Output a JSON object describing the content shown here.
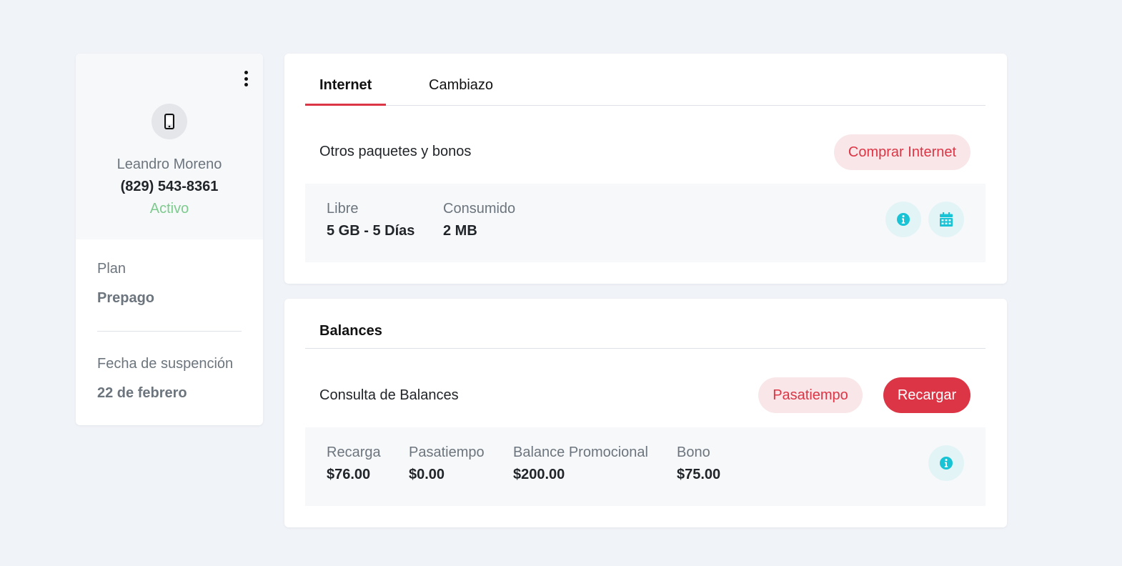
{
  "profile": {
    "menu_icon": "kebab-vertical-icon",
    "avatar_icon": "mobile-phone-icon",
    "name": "Leandro Moreno",
    "phone": "(829) 543-8361",
    "status": "Activo",
    "plan_label": "Plan",
    "plan_value": "Prepago",
    "suspension_label": "Fecha de suspención",
    "suspension_value": "22 de febrero"
  },
  "internet": {
    "tabs": [
      {
        "label": "Internet",
        "active": true
      },
      {
        "label": "Cambiazo",
        "active": false
      }
    ],
    "row_label": "Otros paquetes y bonos",
    "buy_button": "Comprar Internet",
    "stats": [
      {
        "label": "Libre",
        "value": "5 GB - 5 Días"
      },
      {
        "label": "Consumido",
        "value": "2 MB"
      }
    ],
    "icons": [
      "info-icon",
      "calendar-icon"
    ]
  },
  "balances": {
    "title": "Balances",
    "row_label": "Consulta de Balances",
    "pasatiempo_button": "Pasatiempo",
    "recargar_button": "Recargar",
    "stats": [
      {
        "label": "Recarga",
        "value": "$76.00"
      },
      {
        "label": "Pasatiempo",
        "value": "$0.00"
      },
      {
        "label": "Balance Promocional",
        "value": "$200.00"
      },
      {
        "label": "Bono",
        "value": "$75.00"
      }
    ],
    "icons": [
      "info-icon"
    ]
  },
  "colors": {
    "accent": "#dc3545",
    "accent_soft": "#f9e6e8",
    "status_active": "#7ccb8d",
    "icon_teal": "#17c3d4",
    "page_bg": "#f0f3f8"
  }
}
